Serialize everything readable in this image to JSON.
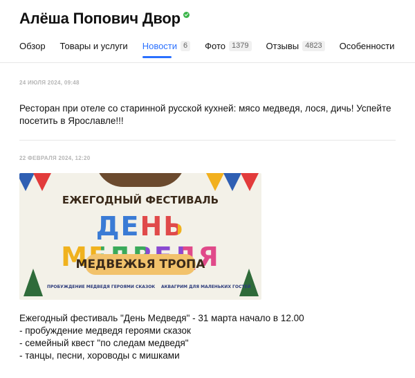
{
  "header": {
    "title": "Алёша Попович Двор",
    "verified_color": "#3bb54a"
  },
  "tabs": [
    {
      "label": "Обзор",
      "count": null,
      "active": false
    },
    {
      "label": "Товары и услуги",
      "count": null,
      "active": false
    },
    {
      "label": "Новости",
      "count": "6",
      "active": true
    },
    {
      "label": "Фото",
      "count": "1379",
      "active": false
    },
    {
      "label": "Отзывы",
      "count": "4823",
      "active": false
    },
    {
      "label": "Особенности",
      "count": null,
      "active": false
    }
  ],
  "accent_color": "#2a70ff",
  "posts": [
    {
      "date": "24 ИЮЛЯ 2024, 09:48",
      "text": "Ресторан при отеле со старинной русской кухней: мясо медведя, лося, дичь! Успейте посетить в Ярославле!!!"
    },
    {
      "date": "22 ФЕВРАЛЯ 2024, 12:20",
      "banner": {
        "line1": "ЕЖЕГОДНЫЙ ФЕСТИВАЛЬ",
        "line2": "ДЕНЬ МЕДВЕДЯ",
        "line3": "МЕДВЕЖЬЯ ТРОПА",
        "bottom_left": "ПРОБУЖДЕНИЕ МЕДВЕДЯ ГЕРОЯМИ СКАЗОК",
        "bottom_right": "АКВАГРИМ ДЛЯ МАЛЕНЬКИХ ГОСТЕЙ"
      },
      "lines": [
        "Ежегодный фестиваль \"День Медведя\" - 31 марта начало в 12.00",
        "- пробуждение медведя героями сказок",
        "- семейный квест \"по следам медведя\"",
        "- танцы, песни, хороводы с мишками"
      ]
    }
  ]
}
